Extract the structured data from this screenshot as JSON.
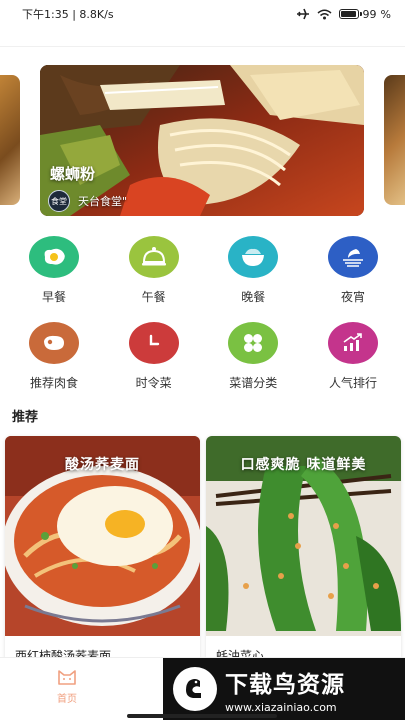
{
  "status_bar": {
    "time_speed": "下午1:35 | 8.8K/s",
    "battery": "99",
    "battery_level": 0.99
  },
  "banner": {
    "title": "螺蛳粉",
    "author": "天台食堂\"",
    "avatar_text": "食堂"
  },
  "categories": [
    {
      "label": "早餐",
      "color": "#2dbd7e",
      "icon": "fried-egg-icon"
    },
    {
      "label": "午餐",
      "color": "#9ac43e",
      "icon": "food-cloche-icon"
    },
    {
      "label": "晚餐",
      "color": "#29b3c6",
      "icon": "rice-bowl-icon"
    },
    {
      "label": "夜宵",
      "color": "#2d5fc5",
      "icon": "moon-icon"
    },
    {
      "label": "推荐肉食",
      "color": "#c96a3a",
      "icon": "steak-icon"
    },
    {
      "label": "时令菜",
      "color": "#cc3b3b",
      "icon": "clock-icon"
    },
    {
      "label": "菜谱分类",
      "color": "#7ac142",
      "icon": "four-leaf-icon"
    },
    {
      "label": "人气排行",
      "color": "#c4348c",
      "icon": "trend-chart-icon"
    }
  ],
  "recommend": {
    "title": "推荐",
    "items": [
      {
        "overlay": "酸汤荞麦面",
        "name": "西红柿酸汤荞麦面"
      },
      {
        "overlay": "口感爽脆 味道鲜美",
        "name": "蚝油菜心"
      }
    ]
  },
  "bottom_nav": {
    "home_label": "首页"
  },
  "watermark": {
    "title": "下载鸟资源",
    "url": "www.xiazainiao.com"
  }
}
